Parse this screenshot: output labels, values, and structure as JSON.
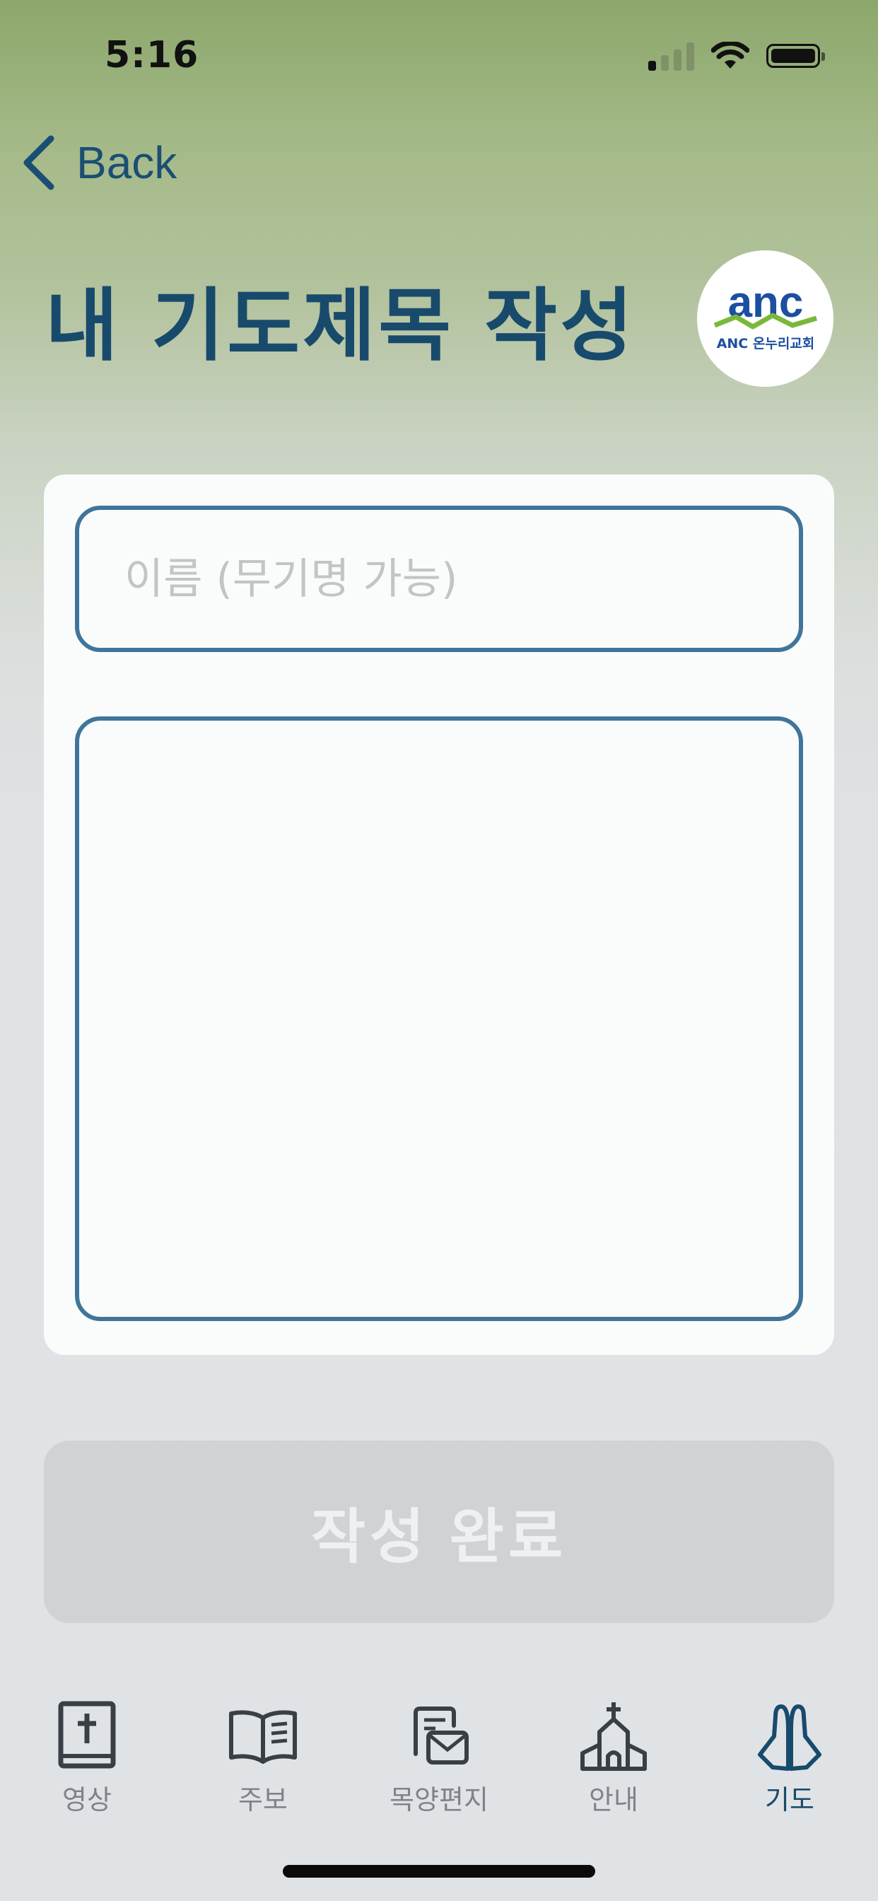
{
  "status_bar": {
    "time": "5:16"
  },
  "nav": {
    "back_label": "Back"
  },
  "page": {
    "title": "내 기도제목 작성",
    "logo": {
      "wordmark": "anc",
      "caption": "ANC 온누리교회"
    }
  },
  "form": {
    "name_placeholder": "이름 (무기명 가능)",
    "name_value": "",
    "content_value": ""
  },
  "submit": {
    "label": "작성 완료",
    "enabled": false
  },
  "tabs": [
    {
      "label": "영상",
      "icon": "bible-icon",
      "active": false
    },
    {
      "label": "주보",
      "icon": "open-book-icon",
      "active": false
    },
    {
      "label": "목양편지",
      "icon": "letter-icon",
      "active": false
    },
    {
      "label": "안내",
      "icon": "church-icon",
      "active": false
    },
    {
      "label": "기도",
      "icon": "praying-hands-icon",
      "active": true
    }
  ],
  "colors": {
    "accent": "#184a6c",
    "input_border": "#3f759b",
    "tab_inactive": "#7f8388",
    "button_disabled": "#cfd3d6"
  }
}
